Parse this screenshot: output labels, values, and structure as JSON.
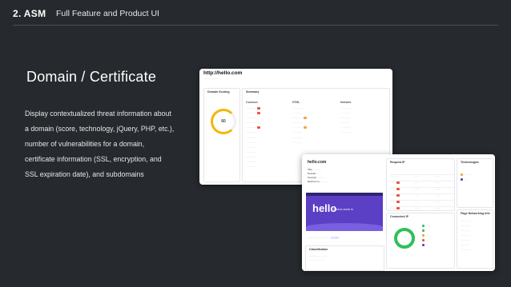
{
  "header": {
    "section_number": "2. ASM",
    "title": "Full Feature and Product UI"
  },
  "slide": {
    "heading": "Domain / Certificate",
    "description_lines": [
      "Display contextualized threat information about",
      "a domain (score, technology, jQuery, PHP, etc.),",
      "number of vulnerabilities for a domain,",
      "certificate information (SSL, encryption, and",
      "SSL expiration date), and subdomains"
    ]
  },
  "domain_screenshot": {
    "url": "http://hello.com",
    "scoring_title": "Domain Scoring",
    "score": "60",
    "summary_title": "Summary",
    "columns": [
      "Common",
      "HTML",
      "Network"
    ]
  },
  "domain_detail_screenshot": {
    "site": "hello.com",
    "fields": [
      "Title",
      "Domain",
      "Inserted",
      "Redirect to"
    ],
    "hero_logo": "hello",
    "hero_cta": "Click to zoom in",
    "request_ip_title": "Request IP",
    "connected_ip_title": "Connected IP",
    "technologies_title": "Technologies",
    "page_networking_title": "Page Networking Info",
    "classification_title": "Classification",
    "colors": {
      "purple": "#5b3fc4",
      "green": "#2fc05a",
      "orange": "#f2a33a",
      "red": "#e5533d"
    }
  }
}
